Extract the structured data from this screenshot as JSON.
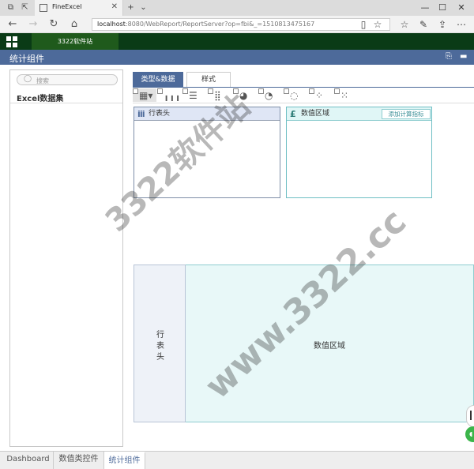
{
  "browser": {
    "tab_title": "FineExcel",
    "url_host": "localhost",
    "url_rest": ":8080/WebReport/ReportServer?op=fbi&_=1510813475167"
  },
  "app": {
    "site_tab": "3322软件站",
    "component_title": "统计组件"
  },
  "left_panel": {
    "search_placeholder": "搜索",
    "dataset_label": "Excel数据集"
  },
  "tabs": {
    "type_data": "类型&数据",
    "style": "样式"
  },
  "chart_types": [
    {
      "icon": "table-icon",
      "glyph": "▦▾"
    },
    {
      "icon": "bar-chart-icon",
      "glyph": "╻╻╻"
    },
    {
      "icon": "hbar-chart-icon",
      "glyph": "☰"
    },
    {
      "icon": "stacked-bar-icon",
      "glyph": "⣿"
    },
    {
      "icon": "pie-chart-icon",
      "glyph": "◕"
    },
    {
      "icon": "gauge-icon",
      "glyph": "◔"
    },
    {
      "icon": "donut-chart-icon",
      "glyph": "◌"
    },
    {
      "icon": "bubble-chart-icon",
      "glyph": "⁘"
    },
    {
      "icon": "scatter-chart-icon",
      "glyph": "⁙"
    }
  ],
  "drop_zones": {
    "row_header_label": "行表头",
    "value_area_label": "数值区域",
    "add_calc_label": "添加计算指标"
  },
  "preview": {
    "row_label": "行表头",
    "value_label": "数值区域"
  },
  "bottom_tabs": [
    "Dashboard",
    "数值类控件",
    "统计组件"
  ],
  "watermark": {
    "line1": "3322软件站",
    "line2": "www.3322.cc"
  },
  "colors": {
    "app_bar": "#0a3b16",
    "accent": "#4d6a9a",
    "value_teal": "#e8f8f8"
  }
}
